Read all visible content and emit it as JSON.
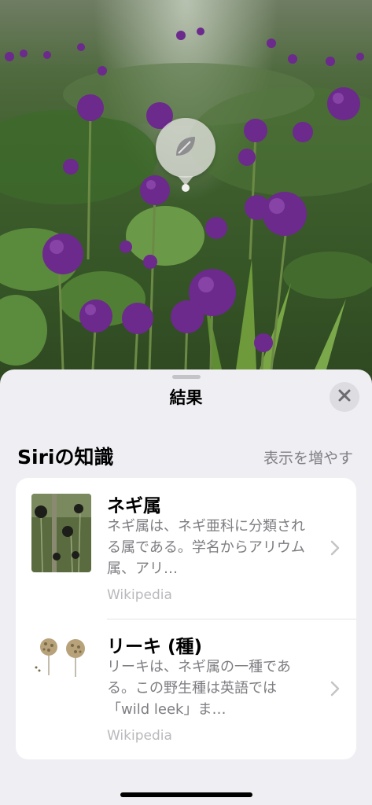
{
  "photo": {
    "subject": "Allium flowers in garden"
  },
  "lookup_pin": {
    "icon": "leaf-icon"
  },
  "sheet": {
    "title": "結果",
    "close_icon": "close-icon"
  },
  "section": {
    "title": "Siriの知識",
    "show_more": "表示を増やす"
  },
  "results": [
    {
      "title": "ネギ属",
      "description": "ネギ属は、ネギ亜科に分類される属である。学名からアリウム属、アリ…",
      "source": "Wikipedia"
    },
    {
      "title": "リーキ (種)",
      "description": "リーキは、ネギ属の一種である。この野生種は英語では「wild leek」ま…",
      "source": "Wikipedia"
    }
  ],
  "colors": {
    "sheet_bg": "#efeef3",
    "card_bg": "#ffffff",
    "secondary_text": "#7d7d82",
    "source_text": "#b9b9bd",
    "allium_purple": "#6b2a8c"
  }
}
